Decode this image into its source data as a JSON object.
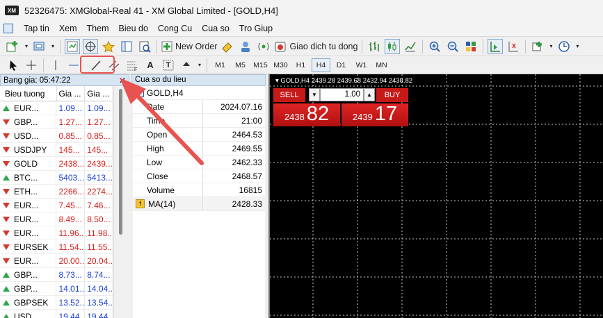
{
  "window": {
    "title": "52326475: XMGlobal-Real 41 - XM Global Limited - [GOLD,H4]",
    "logo": "XM"
  },
  "menu": [
    "Tap tin",
    "Xem",
    "Them",
    "Bieu do",
    "Cong Cu",
    "Cua so",
    "Tro Giup"
  ],
  "toolbar1": {
    "new_order": "New Order",
    "auto_trading": "Giao dich tu dong"
  },
  "timeframes": [
    "M1",
    "M5",
    "M15",
    "M30",
    "H1",
    "H4",
    "D1",
    "W1",
    "MN"
  ],
  "active_timeframe": "H4",
  "drawing_tools": {
    "text_tool": "A",
    "text_label_tool": "T"
  },
  "market_watch": {
    "title": "Bang gia: 05:47:22",
    "col_symbol": "Bieu tuong",
    "col_bid": "Gia ...",
    "col_ask": "Gia ...",
    "rows": [
      {
        "symbol": "EUR...",
        "bid": "1.09...",
        "ask": "1.09...",
        "dir": "up",
        "color": "blue"
      },
      {
        "symbol": "GBP...",
        "bid": "1.27...",
        "ask": "1.27...",
        "dir": "down",
        "color": "red"
      },
      {
        "symbol": "USD...",
        "bid": "0.85...",
        "ask": "0.85...",
        "dir": "down",
        "color": "red"
      },
      {
        "symbol": "USDJPY",
        "bid": "145...",
        "ask": "145...",
        "dir": "down",
        "color": "red"
      },
      {
        "symbol": "GOLD",
        "bid": "2438...",
        "ask": "2439...",
        "dir": "down",
        "color": "red"
      },
      {
        "symbol": "BTC...",
        "bid": "5403...",
        "ask": "5413...",
        "dir": "up",
        "color": "blue"
      },
      {
        "symbol": "ETH...",
        "bid": "2266...",
        "ask": "2274...",
        "dir": "down",
        "color": "red"
      },
      {
        "symbol": "EUR...",
        "bid": "7.45...",
        "ask": "7.46...",
        "dir": "down",
        "color": "red"
      },
      {
        "symbol": "EUR...",
        "bid": "8.49...",
        "ask": "8.50...",
        "dir": "down",
        "color": "red"
      },
      {
        "symbol": "EUR...",
        "bid": "11.96...",
        "ask": "11.98...",
        "dir": "down",
        "color": "red"
      },
      {
        "symbol": "EURSEK",
        "bid": "11.54...",
        "ask": "11.55...",
        "dir": "down",
        "color": "red"
      },
      {
        "symbol": "EUR...",
        "bid": "20.00...",
        "ask": "20.04...",
        "dir": "down",
        "color": "red"
      },
      {
        "symbol": "GBP...",
        "bid": "8.73...",
        "ask": "8.74...",
        "dir": "up",
        "color": "blue"
      },
      {
        "symbol": "GBP...",
        "bid": "14.01...",
        "ask": "14.04...",
        "dir": "up",
        "color": "blue"
      },
      {
        "symbol": "GBPSEK",
        "bid": "13.52...",
        "ask": "13.54...",
        "dir": "up",
        "color": "blue"
      },
      {
        "symbol": "USD...",
        "bid": "19.44...",
        "ask": "19.44...",
        "dir": "up",
        "color": "blue"
      }
    ]
  },
  "data_window": {
    "title": "Cua so du lieu",
    "symbol": "GOLD,H4",
    "rows": [
      {
        "label": "Date",
        "value": "2024.07.16"
      },
      {
        "label": "Time",
        "value": "21:00"
      },
      {
        "label": "Open",
        "value": "2464.53"
      },
      {
        "label": "High",
        "value": "2469.55"
      },
      {
        "label": "Low",
        "value": "2462.33"
      },
      {
        "label": "Close",
        "value": "2468.57"
      },
      {
        "label": "Volume",
        "value": "16815"
      }
    ],
    "ma": {
      "label": "MA(14)",
      "value": "2428.33"
    }
  },
  "chart": {
    "info": "GOLD,H4  2439.28  2439.68  2432.94  2438.82",
    "one_click": {
      "sell_label": "SELL",
      "buy_label": "BUY",
      "lot": "1.00",
      "sell_price_prefix": "2438",
      "sell_price_big": "82",
      "buy_price_prefix": "2439",
      "buy_price_big": "17"
    }
  },
  "colors": {
    "accent_red": "#e8524f",
    "sell_buy": "#c61a1a",
    "chart_bg": "#000000"
  }
}
